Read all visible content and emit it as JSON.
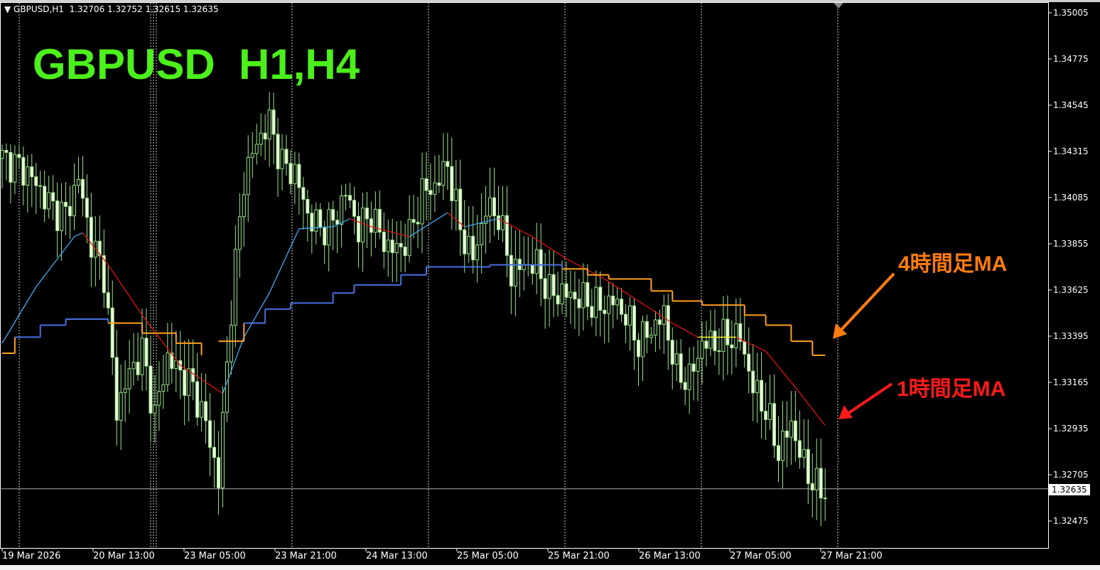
{
  "header": {
    "symbol": "GBPUSD,H1",
    "ohlc": "1.32706 1.32752 1.32615 1.32635"
  },
  "title_overlay": "GBPUSD  H1,H4",
  "annotations": {
    "h4_ma": "4時間足MA",
    "h1_ma": "1時間足MA"
  },
  "current_price": "1.32635",
  "colors": {
    "bull": "#000000",
    "bear": "#f0ffe0",
    "wick": "#9ae68a",
    "ma_up": "#3fa9f5",
    "ma_down": "#e01010",
    "ma_flat": "#ffff33",
    "h4_up": "#4a6fe0",
    "h4_down": "#ffa020",
    "title": "#4cf01a"
  },
  "chart_data": {
    "type": "candlestick",
    "title": "GBPUSD,H1",
    "y_ticks": [
      "1.35005",
      "1.34775",
      "1.34545",
      "1.34315",
      "1.34085",
      "1.33855",
      "1.33625",
      "1.33395",
      "1.33165",
      "1.32935",
      "1.32705",
      "1.32475"
    ],
    "ylim": [
      1.32475,
      1.35005
    ],
    "x_ticks": [
      "19 Mar 2026",
      "20 Mar 13:00",
      "23 Mar 05:00",
      "23 Mar 21:00",
      "24 Mar 13:00",
      "25 Mar 05:00",
      "25 Mar 21:00",
      "26 Mar 13:00",
      "27 Mar 05:00",
      "27 Mar 21:00"
    ],
    "bars": 195,
    "close_waypoints": [
      [
        0,
        1.3428
      ],
      [
        3,
        1.3425
      ],
      [
        6,
        1.3421
      ],
      [
        9,
        1.3412
      ],
      [
        12,
        1.3403
      ],
      [
        15,
        1.34
      ],
      [
        18,
        1.3418
      ],
      [
        21,
        1.3386
      ],
      [
        24,
        1.3371
      ],
      [
        27,
        1.3303
      ],
      [
        30,
        1.3321
      ],
      [
        33,
        1.3332
      ],
      [
        36,
        1.33
      ],
      [
        39,
        1.3329
      ],
      [
        42,
        1.3321
      ],
      [
        45,
        1.3314
      ],
      [
        48,
        1.3296
      ],
      [
        51,
        1.3268
      ],
      [
        54,
        1.3354
      ],
      [
        57,
        1.3418
      ],
      [
        60,
        1.3436
      ],
      [
        63,
        1.3446
      ],
      [
        66,
        1.3425
      ],
      [
        69,
        1.3421
      ],
      [
        72,
        1.34
      ],
      [
        75,
        1.3393
      ],
      [
        78,
        1.3396
      ],
      [
        81,
        1.3411
      ],
      [
        84,
        1.3393
      ],
      [
        87,
        1.34
      ],
      [
        90,
        1.3386
      ],
      [
        93,
        1.3382
      ],
      [
        96,
        1.3389
      ],
      [
        99,
        1.3411
      ],
      [
        102,
        1.3414
      ],
      [
        105,
        1.3425
      ],
      [
        108,
        1.3393
      ],
      [
        111,
        1.3378
      ],
      [
        114,
        1.3403
      ],
      [
        117,
        1.34
      ],
      [
        120,
        1.3371
      ],
      [
        123,
        1.3375
      ],
      [
        126,
        1.3375
      ],
      [
        129,
        1.3361
      ],
      [
        132,
        1.3361
      ],
      [
        135,
        1.3359
      ],
      [
        138,
        1.3357
      ],
      [
        141,
        1.3354
      ],
      [
        144,
        1.3357
      ],
      [
        147,
        1.335
      ],
      [
        150,
        1.3336
      ],
      [
        153,
        1.3343
      ],
      [
        156,
        1.335
      ],
      [
        159,
        1.3321
      ],
      [
        162,
        1.3318
      ],
      [
        165,
        1.3336
      ],
      [
        168,
        1.3336
      ],
      [
        171,
        1.3339
      ],
      [
        174,
        1.3339
      ],
      [
        177,
        1.3314
      ],
      [
        180,
        1.3303
      ],
      [
        183,
        1.3282
      ],
      [
        186,
        1.3296
      ],
      [
        189,
        1.3275
      ],
      [
        192,
        1.3264
      ],
      [
        194,
        1.3262
      ]
    ],
    "series": [
      {
        "name": "1時間足MA",
        "segments": [
          [
            [
              0,
              1.3336
            ],
            [
              8,
              1.3364
            ],
            [
              17,
              1.3389
            ],
            [
              19,
              1.3391
            ],
            [
              25,
              1.3375
            ],
            [
              33,
              1.335
            ],
            [
              42,
              1.3325
            ],
            [
              52,
              1.3311
            ]
          ],
          [
            [
              52,
              1.3311
            ],
            [
              57,
              1.3339
            ],
            [
              63,
              1.3361
            ],
            [
              70,
              1.3393
            ],
            [
              78,
              1.3394
            ],
            [
              82,
              1.3398
            ],
            [
              87,
              1.3394
            ],
            [
              96,
              1.3389
            ],
            [
              105,
              1.3401
            ],
            [
              109,
              1.3394
            ],
            [
              117,
              1.3398
            ],
            [
              125,
              1.3389
            ],
            [
              133,
              1.3378
            ],
            [
              142,
              1.3368
            ],
            [
              150,
              1.3357
            ],
            [
              158,
              1.3346
            ],
            [
              164,
              1.3339
            ],
            [
              173,
              1.3339
            ],
            [
              180,
              1.3332
            ],
            [
              187,
              1.3314
            ],
            [
              194,
              1.3295
            ]
          ]
        ]
      },
      {
        "name": "4時間足MA",
        "steps": [
          [
            0,
            1.3331
          ],
          [
            3,
            1.3339
          ],
          [
            9,
            1.3345
          ],
          [
            15,
            1.3348
          ],
          [
            25,
            1.3346
          ],
          [
            33,
            1.3341
          ],
          [
            41,
            1.3336
          ],
          [
            47,
            1.333
          ],
          [
            51,
            null
          ],
          [
            51,
            1.3337
          ],
          [
            57,
            1.3346
          ],
          [
            62,
            1.3353
          ],
          [
            68,
            1.3356
          ],
          [
            78,
            1.3361
          ],
          [
            83,
            1.3365
          ],
          [
            94,
            1.337
          ],
          [
            100,
            1.3374
          ],
          [
            115,
            1.3375
          ],
          [
            132,
            1.3373
          ],
          [
            138,
            1.337
          ],
          [
            143,
            1.3368
          ],
          [
            153,
            1.3362
          ],
          [
            158,
            1.3357
          ],
          [
            165,
            1.3355
          ],
          [
            175,
            1.335
          ],
          [
            180,
            1.3345
          ],
          [
            186,
            1.3337
          ],
          [
            191,
            1.333
          ],
          [
            194,
            1.333
          ]
        ]
      }
    ]
  }
}
